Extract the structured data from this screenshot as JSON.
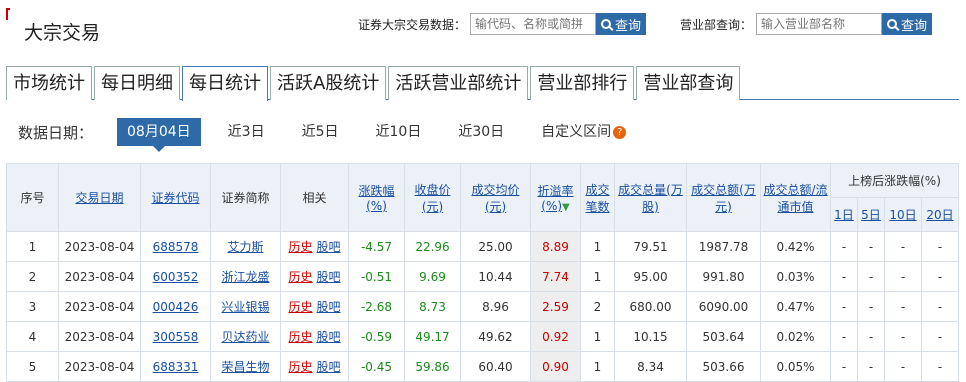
{
  "header": {
    "title": "大宗交易",
    "search1_label": "证券大宗交易数据：",
    "search1_placeholder": "输代码、名称或简拼",
    "search_button": "查询",
    "search2_label": "营业部查询：",
    "search2_placeholder": "输入营业部名称"
  },
  "tabs": [
    "市场统计",
    "每日明细",
    "每日统计",
    "活跃A股统计",
    "活跃营业部统计",
    "营业部排行",
    "营业部查询"
  ],
  "active_tab": "每日统计",
  "datebar": {
    "label": "数据日期：",
    "options": [
      "08月04日",
      "近3日",
      "近5日",
      "近10日",
      "近30日",
      "自定义区间"
    ],
    "active": "08月04日"
  },
  "table": {
    "headers": {
      "seq": "序号",
      "date": "交易日期",
      "code": "证券代码",
      "name": "证券简称",
      "related": "相关",
      "chg": "涨跌幅(%)",
      "close": "收盘价(元)",
      "avg": "成交均价(元)",
      "premium": "折溢率(%)",
      "count": "成交笔数",
      "vol": "成交总量(万股)",
      "amt": "成交总额(万元)",
      "ratio": "成交总额/流通市值",
      "after": "上榜后涨跌幅(%)",
      "d1": "1日",
      "d5": "5日",
      "d10": "10日",
      "d20": "20日"
    },
    "related_links": {
      "history": "历史",
      "guba": "股吧"
    },
    "rows": [
      {
        "seq": "1",
        "date": "2023-08-04",
        "code": "688578",
        "name": "艾力斯",
        "chg": "-4.57",
        "close": "22.96",
        "avg": "25.00",
        "premium": "8.89",
        "count": "1",
        "vol": "79.51",
        "amt": "1987.78",
        "ratio": "0.42%",
        "d1": "-",
        "d5": "-",
        "d10": "-",
        "d20": "-"
      },
      {
        "seq": "2",
        "date": "2023-08-04",
        "code": "600352",
        "name": "浙江龙盛",
        "chg": "-0.51",
        "close": "9.69",
        "avg": "10.44",
        "premium": "7.74",
        "count": "1",
        "vol": "95.00",
        "amt": "991.80",
        "ratio": "0.03%",
        "d1": "-",
        "d5": "-",
        "d10": "-",
        "d20": "-"
      },
      {
        "seq": "3",
        "date": "2023-08-04",
        "code": "000426",
        "name": "兴业银锡",
        "chg": "-2.68",
        "close": "8.73",
        "avg": "8.96",
        "premium": "2.59",
        "count": "2",
        "vol": "680.00",
        "amt": "6090.00",
        "ratio": "0.47%",
        "d1": "-",
        "d5": "-",
        "d10": "-",
        "d20": "-"
      },
      {
        "seq": "4",
        "date": "2023-08-04",
        "code": "300558",
        "name": "贝达药业",
        "chg": "-0.59",
        "close": "49.17",
        "avg": "49.62",
        "premium": "0.92",
        "count": "1",
        "vol": "10.15",
        "amt": "503.64",
        "ratio": "0.02%",
        "d1": "-",
        "d5": "-",
        "d10": "-",
        "d20": "-"
      },
      {
        "seq": "5",
        "date": "2023-08-04",
        "code": "688331",
        "name": "荣昌生物",
        "chg": "-0.45",
        "close": "59.86",
        "avg": "60.40",
        "premium": "0.90",
        "count": "1",
        "vol": "8.34",
        "amt": "503.66",
        "ratio": "0.05%",
        "d1": "-",
        "d5": "-",
        "d10": "-",
        "d20": "-"
      }
    ]
  }
}
